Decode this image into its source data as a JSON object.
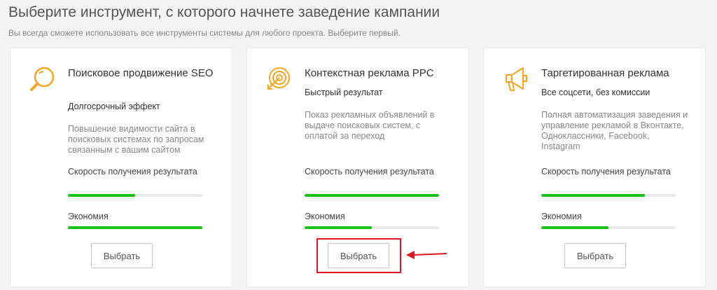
{
  "header": {
    "title": "Выберите инструмент, с которого начнете заведение кампании",
    "subtitle": "Вы всегда сможете использовать все инструменты системы для любого проекта. Выберите первый."
  },
  "cards": [
    {
      "icon": "search-icon",
      "title": "Поисковое продвижение SEO",
      "subtitle": "Долгосрочный эффект",
      "description": "Повышение видимости сайта в поисковых системах по запросам связанным с вашим сайтом",
      "metrics": [
        {
          "label": "Скорость получения результата",
          "value": 0.5
        },
        {
          "label": "Экономия",
          "value": 1.0
        }
      ],
      "button_label": "Выбрать"
    },
    {
      "icon": "target-icon",
      "title": "Контекстная реклама PPC",
      "subtitle": "Быстрый результат",
      "description": "Показ рекламных объявлений в выдаче поисковых систем, с оплатой за переход",
      "metrics": [
        {
          "label": "Скорость получения результата",
          "value": 1.0
        },
        {
          "label": "Экономия",
          "value": 0.5
        }
      ],
      "button_label": "Выбрать"
    },
    {
      "icon": "megaphone-icon",
      "title": "Таргетированная реклама",
      "subtitle": "Все соцсети, без комиссии",
      "description": "Полная автоматизация заведения и управление рекламой в Вконтакте, Одноклассники, Facebook, Instagram",
      "metrics": [
        {
          "label": "Скорость получения результата",
          "value": 0.77
        },
        {
          "label": "Экономия",
          "value": 0.5
        }
      ],
      "button_label": "Выбрать"
    }
  ],
  "colors": {
    "accent_icon": "#f5a623",
    "bar_fill": "#19c219",
    "highlight": "#e0151f"
  }
}
